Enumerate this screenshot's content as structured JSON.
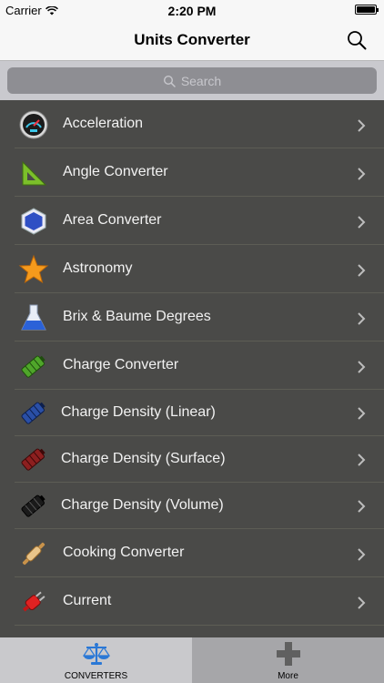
{
  "status": {
    "carrier": "Carrier",
    "time": "2:20 PM"
  },
  "nav": {
    "title": "Units Converter"
  },
  "search": {
    "placeholder": "Search"
  },
  "list": {
    "items": [
      {
        "label": "Acceleration",
        "icon": "speedometer-icon"
      },
      {
        "label": "Angle Converter",
        "icon": "set-square-icon"
      },
      {
        "label": "Area Converter",
        "icon": "hexagon-icon"
      },
      {
        "label": "Astronomy",
        "icon": "star-icon"
      },
      {
        "label": "Brix & Baume Degrees",
        "icon": "flask-icon"
      },
      {
        "label": "Charge Converter",
        "icon": "battery-green-icon"
      },
      {
        "label": "Charge Density (Linear)",
        "icon": "battery-blue-icon"
      },
      {
        "label": "Charge Density (Surface)",
        "icon": "battery-red-icon"
      },
      {
        "label": "Charge Density (Volume)",
        "icon": "battery-black-icon"
      },
      {
        "label": "Cooking Converter",
        "icon": "rolling-pin-icon"
      },
      {
        "label": "Current",
        "icon": "plug-icon"
      }
    ]
  },
  "tabs": [
    {
      "label": "CONVERTERS",
      "icon": "scales-icon",
      "active": true
    },
    {
      "label": "More",
      "icon": "plus-icon",
      "active": false
    }
  ],
  "colors": {
    "list_bg": "#4a4a48",
    "separator": "#5d5d55",
    "tab_active": "#c9c9cc",
    "accent": "#2a78d6"
  }
}
